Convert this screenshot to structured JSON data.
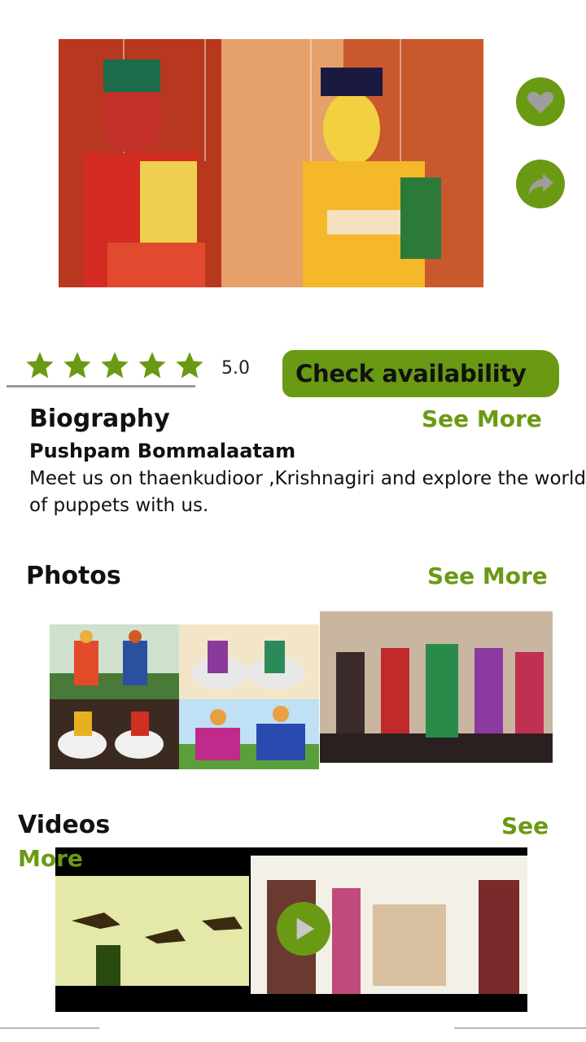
{
  "hero": {
    "image_desc": "puppets",
    "like_icon": "heart-icon",
    "share_icon": "share-arrow-icon"
  },
  "rating": {
    "stars": 5,
    "value": "5.0"
  },
  "actions": {
    "check_availability": "Check availability"
  },
  "biography": {
    "title": "Biography",
    "see_more": "See More",
    "name": "Pushpam Bommalaatam",
    "text": "Meet us on thaenkudioor ,Krishnagiri and explore the world of puppets with us."
  },
  "photos": {
    "title": "Photos",
    "see_more": "See More"
  },
  "videos": {
    "title": "Videos",
    "see_more_1": "See",
    "see_more_2": "More"
  },
  "colors": {
    "accent": "#6a9a13"
  }
}
